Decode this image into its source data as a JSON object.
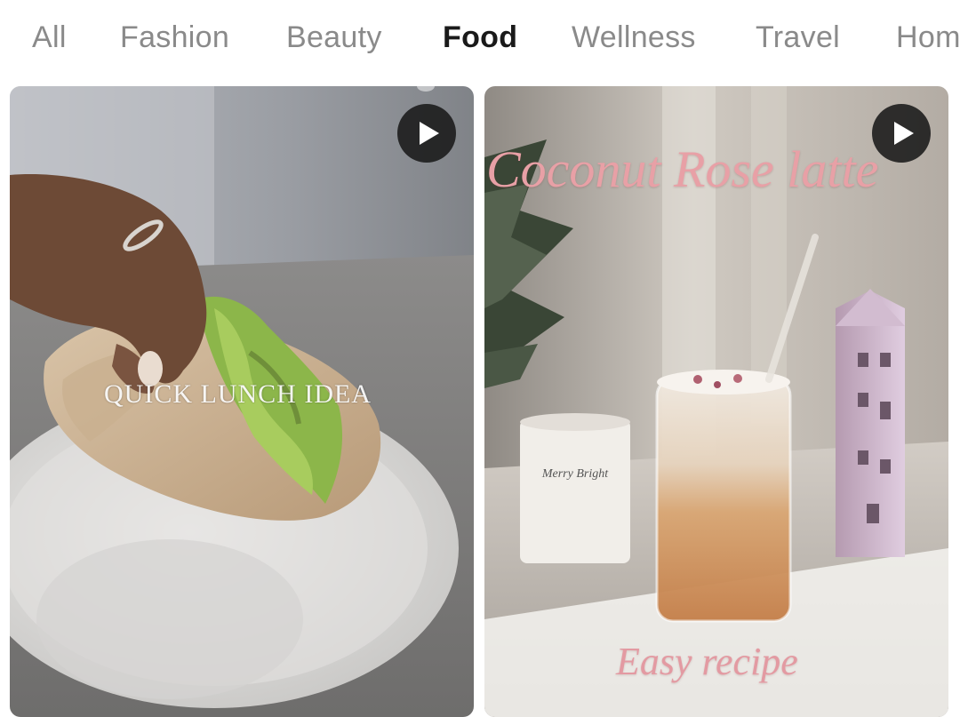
{
  "tabs": [
    {
      "label": "All"
    },
    {
      "label": "Fashion"
    },
    {
      "label": "Beauty"
    },
    {
      "label": "Food"
    },
    {
      "label": "Wellness"
    },
    {
      "label": "Travel"
    },
    {
      "label": "Home"
    }
  ],
  "active_tab": "Food",
  "cards": [
    {
      "overlay_text": "QUICK LUNCH IDEA",
      "play_icon": "play-icon",
      "media_type": "video"
    },
    {
      "overlay_title": "Coconut Rose latte",
      "overlay_subtitle": "Easy recipe",
      "mug_text": "Merry Bright",
      "play_icon": "play-icon",
      "media_type": "video"
    }
  ],
  "colors": {
    "active_tab": "#1a1a1a",
    "inactive_tab": "#8a8a8a",
    "latte_title": "#e8a0a6"
  }
}
